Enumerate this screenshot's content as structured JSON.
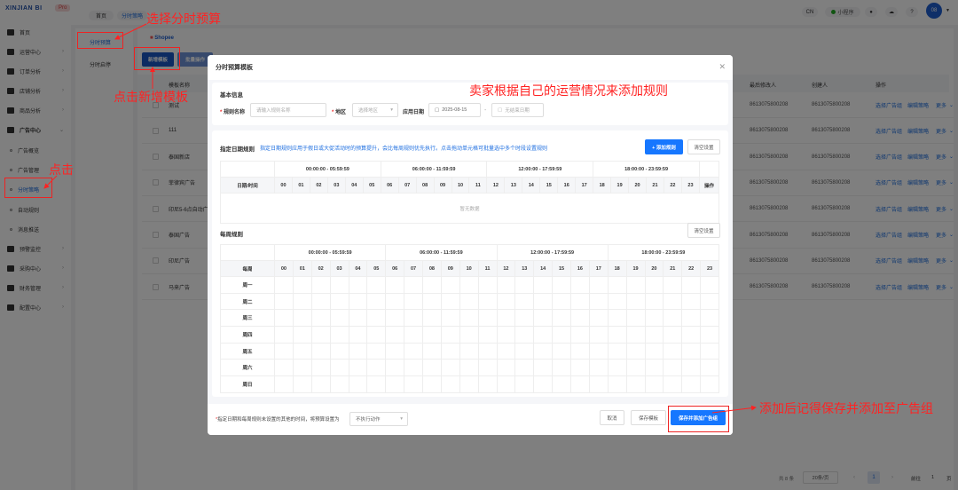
{
  "app": {
    "logo": "XINJIAN BI",
    "badge": "Pro"
  },
  "sidebar": {
    "items": [
      {
        "label": "首页",
        "icon": "home-icon",
        "sub": false
      },
      {
        "label": "运营中心",
        "icon": "monitor-icon",
        "sub": false,
        "chev": true
      },
      {
        "label": "订单分析",
        "icon": "chart-icon",
        "sub": false,
        "chev": true
      },
      {
        "label": "店铺分析",
        "icon": "store-icon",
        "sub": false,
        "chev": true
      },
      {
        "label": "商品分析",
        "icon": "product-icon",
        "sub": false,
        "chev": true
      },
      {
        "label": "广告中心",
        "icon": "ad-icon",
        "sub": false,
        "chev": true,
        "bold": true
      },
      {
        "label": "广告概览",
        "sub": true
      },
      {
        "label": "广告管理",
        "sub": true
      },
      {
        "label": "分时策略",
        "sub": true,
        "active": true
      },
      {
        "label": "自动规则",
        "sub": true
      },
      {
        "label": "消息推送",
        "sub": true
      },
      {
        "label": "预警监控",
        "icon": "alert-icon",
        "sub": false,
        "chev": true
      },
      {
        "label": "采购中心",
        "icon": "purchase-icon",
        "sub": false,
        "chev": true
      },
      {
        "label": "财务管理",
        "icon": "finance-icon",
        "sub": false,
        "chev": true
      },
      {
        "label": "配置中心",
        "icon": "config-icon",
        "sub": false,
        "chev": true
      }
    ]
  },
  "topbar": {
    "tabs": [
      "首页",
      "分时策略"
    ],
    "lang": "CN",
    "miniapp": "小程序",
    "avatar": "08"
  },
  "subnav": {
    "items": [
      "分时预算",
      "分时启停"
    ]
  },
  "main": {
    "platform": "Shopee",
    "new_template": "新增模板",
    "batch": "批量操作",
    "columns": {
      "name": "模板名称",
      "modifier": "最后修改人",
      "creator": "创建人",
      "ops": "操作"
    },
    "rows": [
      {
        "name": "测试",
        "modifier": "8613075800208",
        "creator": "8613075800208"
      },
      {
        "name": "111",
        "modifier": "8613075800208",
        "creator": "8613075800208"
      },
      {
        "name": "泰国新店",
        "modifier": "8613075800208",
        "creator": "8613075800208"
      },
      {
        "name": "菲律宾广告",
        "modifier": "8613075800208",
        "creator": "8613075800208"
      },
      {
        "name": "印尼5-6点自动广…",
        "modifier": "8613075800208",
        "creator": "8613075800208"
      },
      {
        "name": "泰国广告",
        "modifier": "8613075800208",
        "creator": "8613075800208"
      },
      {
        "name": "印尼广告",
        "modifier": "8613075800208",
        "creator": "8613075800208"
      },
      {
        "name": "马来广告",
        "modifier": "8613075800208",
        "creator": "8613075800208"
      }
    ],
    "row_actions": [
      "选择广告组",
      "编辑策略",
      "更多"
    ],
    "pagination": {
      "total": "共 8 条",
      "page_size": "20条/页",
      "current": "1",
      "goto": "前往",
      "goto_value": "1",
      "page_unit": "页"
    }
  },
  "modal": {
    "title": "分时预算模板",
    "basic": {
      "title": "基本信息",
      "name_label": "规则名称",
      "name_placeholder": "请输入规则名称",
      "region_label": "地区",
      "region_placeholder": "选择地区",
      "date_label": "应用日期",
      "start_date": "2025-08-15",
      "end_placeholder": "无结束日期",
      "sep": "-"
    },
    "date_rules": {
      "title": "指定日期规则",
      "hint": "指定日期规则应用于假日或大促活动时的预算提升，会比每周规则优先执行。点击拖动单元格可批量选中多个时段设置规则",
      "add": "+ 添加规则",
      "clear": "清空设置",
      "corner": "日期/时间",
      "ops": "操作",
      "empty": "暂无数据"
    },
    "weekly": {
      "title": "每周规则",
      "clear": "清空设置",
      "corner": "每周",
      "days": [
        "周一",
        "周二",
        "周三",
        "周四",
        "周五",
        "周六",
        "周日"
      ]
    },
    "ranges": [
      "00:00:00 - 05:59:59",
      "06:00:00 - 11:59:59",
      "12:00:00 - 17:59:59",
      "18:00:00 - 23:59:59"
    ],
    "hours": [
      "00",
      "01",
      "02",
      "03",
      "04",
      "05",
      "06",
      "07",
      "08",
      "09",
      "10",
      "11",
      "12",
      "13",
      "14",
      "15",
      "16",
      "17",
      "18",
      "19",
      "20",
      "21",
      "22",
      "23"
    ],
    "footer": {
      "note": "指定日期和每周规则未设置的其他的时间，将预算设置为",
      "default_action": "不执行动作",
      "cancel": "取消",
      "save_template": "保存模板",
      "save_add": "保存并添加广告组"
    }
  },
  "annotations": {
    "a1": "选择分时预算",
    "a2": "点击新增模板",
    "a3": "点击",
    "a4": "卖家根据自己的运营情况来添加规则",
    "a5": "添加后记得保存并添加至广告组",
    "color": "#ff2222"
  }
}
